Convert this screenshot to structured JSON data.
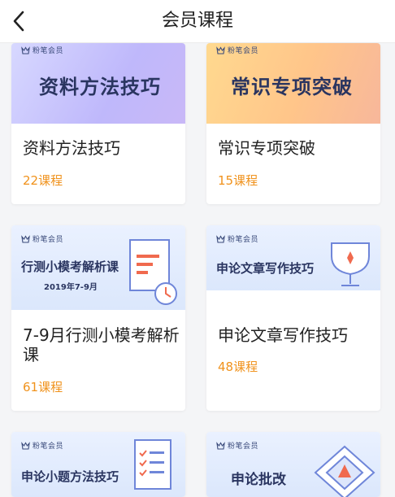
{
  "header": {
    "title": "会员课程",
    "back_icon": "chevron-left-icon"
  },
  "brand_label": "粉笔会员",
  "courses": [
    {
      "banner_text": "资料方法技巧",
      "name": "资料方法技巧",
      "count": "22课程"
    },
    {
      "banner_text": "常识专项突破",
      "name": "常识专项突破",
      "count": "15课程"
    },
    {
      "banner_text": "行测小模考解析课",
      "banner_subtext": "2019年7-9月",
      "name_line1": "7-9月行测小模考解析",
      "name_line2": "课",
      "count": "61课程"
    },
    {
      "banner_text": "申论文章写作技巧",
      "name": "申论文章写作技巧",
      "count": "48课程"
    },
    {
      "banner_text": "申论小题方法技巧"
    },
    {
      "banner_text": "申论批改"
    }
  ],
  "colors": {
    "accent": "#f0921c",
    "banner_blue": "#e4ecfb",
    "title_text": "#222222"
  }
}
